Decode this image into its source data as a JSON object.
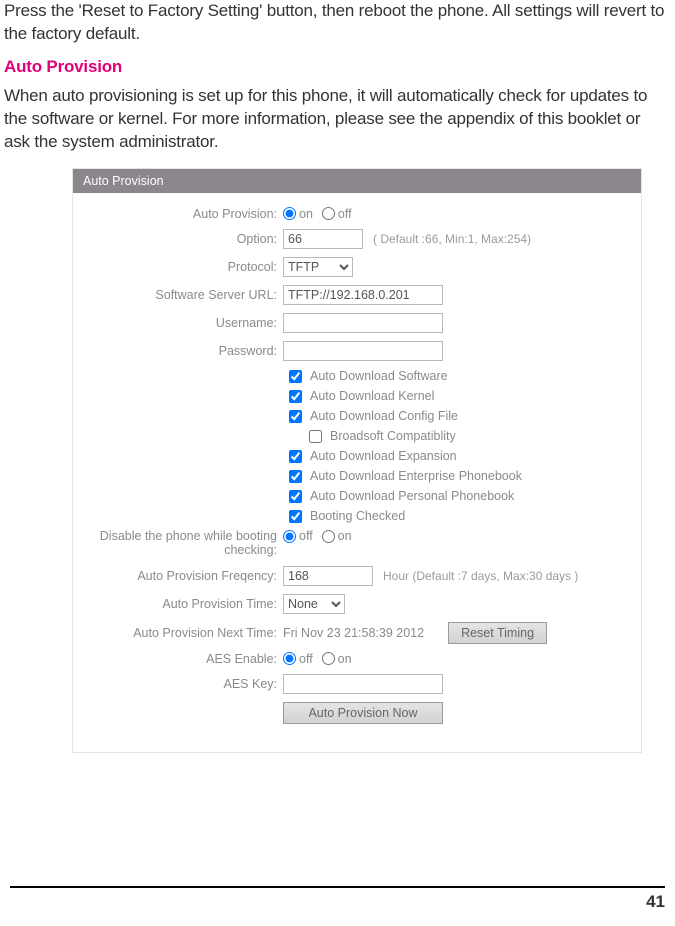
{
  "para1": "Press the 'Reset to Factory Setting' button, then reboot the phone.  All settings will revert to the factory default.",
  "section_title": "Auto Provision",
  "para2": "When auto provisioning is set up for this phone, it will automatically check for updates to the software or kernel.  For more information, please see the appendix of this booklet or ask the system administrator.",
  "panel": {
    "title": "Auto Provision",
    "labels": {
      "auto_provision": "Auto Provision:",
      "option": "Option:",
      "protocol": "Protocol:",
      "server_url": "Software Server URL:",
      "username": "Username:",
      "password": "Password:",
      "disable_boot": "Disable the phone while booting checking:",
      "freq": "Auto Provision Freqency:",
      "time": "Auto Provision Time:",
      "next_time": "Auto Provision Next Time:",
      "aes_enable": "AES Enable:",
      "aes_key": "AES Key:"
    },
    "values": {
      "option": "66",
      "option_hint": "( Default :66, Min:1, Max:254)",
      "protocol": "TFTP",
      "server_url": "TFTP://192.168.0.201",
      "username": "",
      "password": "",
      "freq": "168",
      "freq_hint": "Hour (Default :7 days, Max:30 days )",
      "time": "None",
      "next_time": "Fri Nov 23 21:58:39 2012"
    },
    "radios": {
      "on": "on",
      "off": "off"
    },
    "checks": {
      "dl_software": "Auto Download Software",
      "dl_kernel": "Auto Download Kernel",
      "dl_config": "Auto Download Config File",
      "broadsoft": "Broadsoft Compatiblity",
      "dl_expansion": "Auto Download Expansion",
      "dl_ent_pb": "Auto Download Enterprise Phonebook",
      "dl_pers_pb": "Auto Download Personal Phonebook",
      "boot_chk": "Booting Checked"
    },
    "buttons": {
      "reset_timing": "Reset Timing",
      "provision_now": "Auto Provision Now"
    }
  },
  "page_number": "41"
}
